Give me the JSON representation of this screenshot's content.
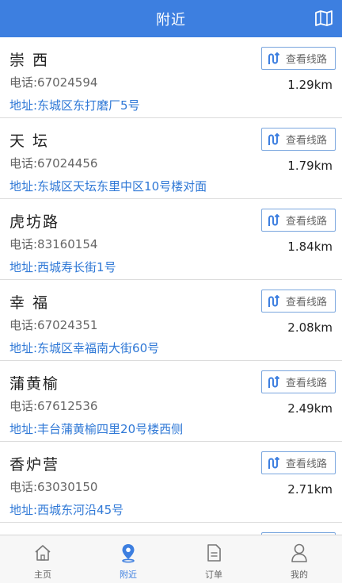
{
  "header": {
    "title": "附近"
  },
  "list": {
    "route_label": "查看线路",
    "items": [
      {
        "name": "崇 西",
        "phone": "电话:67024594",
        "address": "地址:东城区东打磨厂5号",
        "distance": "1.29km"
      },
      {
        "name": "天 坛",
        "phone": "电话:67024456",
        "address": "地址:东城区天坛东里中区10号楼对面",
        "distance": "1.79km"
      },
      {
        "name": "虎坊路",
        "phone": "电话:83160154",
        "address": "地址:西城寿长街1号",
        "distance": "1.84km"
      },
      {
        "name": "幸 福",
        "phone": "电话:67024351",
        "address": "地址:东城区幸福南大街60号",
        "distance": "2.08km"
      },
      {
        "name": "蒲黄榆",
        "phone": "电话:67612536",
        "address": "地址:丰台蒲黄榆四里20号楼西侧",
        "distance": "2.49km"
      },
      {
        "name": "香炉营",
        "phone": "电话:63030150",
        "address": "地址:西城东河沿45号",
        "distance": "2.71km"
      }
    ]
  },
  "tabbar": {
    "tabs": [
      {
        "label": "主页",
        "icon": "home-icon",
        "active": false
      },
      {
        "label": "附近",
        "icon": "location-pin-icon",
        "active": true
      },
      {
        "label": "订单",
        "icon": "order-document-icon",
        "active": false
      },
      {
        "label": "我的",
        "icon": "user-profile-icon",
        "active": false
      }
    ]
  },
  "colors": {
    "primary": "#3d7fe0",
    "address": "#2f78d6",
    "divider": "#dcdcdc"
  }
}
